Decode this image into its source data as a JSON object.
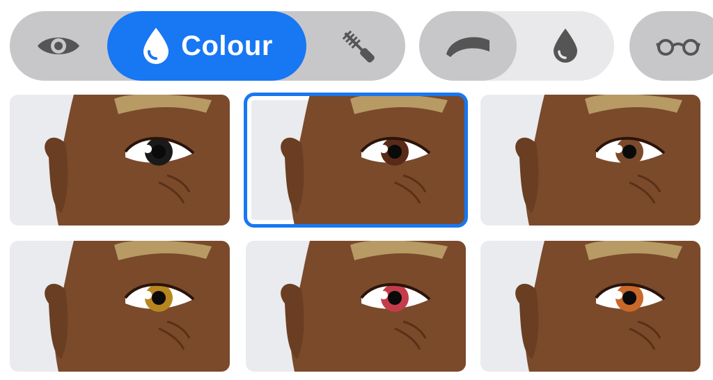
{
  "toolbar": {
    "eye_group": {
      "tabs": [
        {
          "id": "eye-shape",
          "icon": "eye-icon",
          "label": "",
          "active": false
        },
        {
          "id": "colour",
          "icon": "drop-icon",
          "label": "Colour",
          "active": true
        },
        {
          "id": "mascara",
          "icon": "mascara-icon",
          "label": "",
          "active": false
        }
      ]
    },
    "brow_group": {
      "tabs": [
        {
          "id": "eyebrow",
          "icon": "eyebrow-icon",
          "active": true
        },
        {
          "id": "brow-colour",
          "icon": "drop-icon",
          "active": false
        }
      ]
    },
    "glasses_group": {
      "tabs": [
        {
          "id": "glasses",
          "icon": "glasses-icon",
          "active": false
        }
      ]
    }
  },
  "colors": {
    "accent": "#1877f2",
    "skin": "#7a4a2b",
    "hair": "#b79a64",
    "background": "#e9ebee"
  },
  "eye_colour_options": [
    {
      "name": "dark",
      "iris": "#1a1a1a",
      "selected": false
    },
    {
      "name": "dark-brown",
      "iris": "#5a2a18",
      "selected": true
    },
    {
      "name": "brown",
      "iris": "#7a4a2a",
      "selected": false
    },
    {
      "name": "amber",
      "iris": "#b8861f",
      "selected": false
    },
    {
      "name": "red",
      "iris": "#c43c4a",
      "selected": false
    },
    {
      "name": "orange",
      "iris": "#c8682a",
      "selected": false
    }
  ]
}
